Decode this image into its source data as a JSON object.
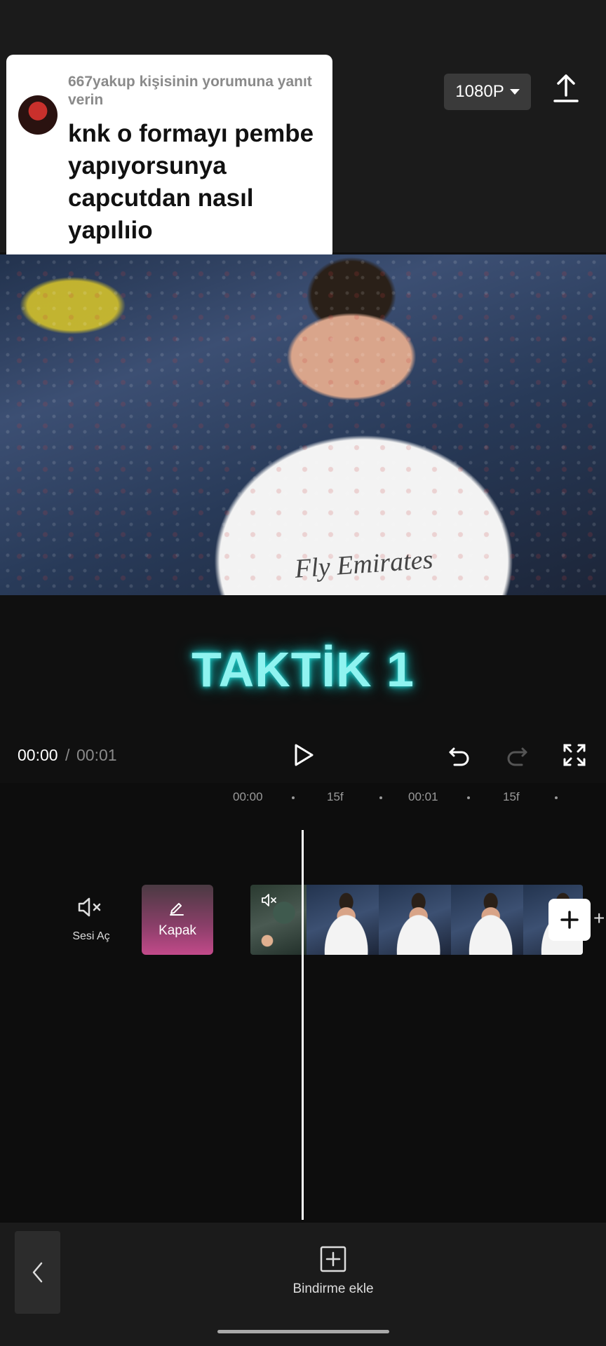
{
  "header": {
    "resolution_label": "1080P",
    "export_icon": "upload-icon"
  },
  "comment": {
    "reply_line": "667yakup kişisinin yorumuna yanıt verin",
    "text": "knk o formayı pembe yapıyorsunya capcutdan nasıl yapılıio"
  },
  "preview": {
    "jersey_text": "Fly Emirates",
    "overlay_title": "TAKTİK 1"
  },
  "playback": {
    "current_time": "00:00",
    "separator": "/",
    "total_time": "00:01"
  },
  "timeline": {
    "ruler": [
      "00:00",
      "15f",
      "00:01",
      "15f"
    ],
    "mute_label": "Sesi Aç",
    "cover_label": "Kapak",
    "add_clip_extra": "+"
  },
  "toolbar": {
    "overlay_add_label": "Bindirme ekle"
  },
  "colors": {
    "title_glow": "#22d3d0",
    "background": "#101010",
    "bar": "#1b1b1b"
  }
}
